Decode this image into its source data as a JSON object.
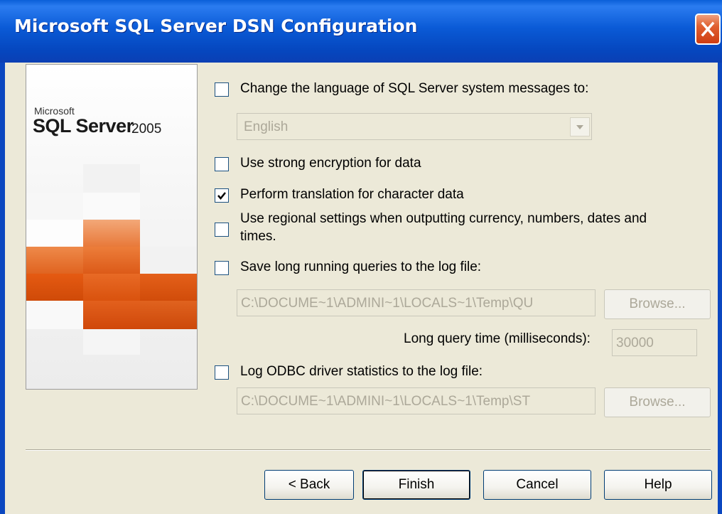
{
  "window": {
    "title": "Microsoft SQL Server DSN Configuration"
  },
  "logo": {
    "brand": "Microsoft",
    "product": "SQL Server",
    "year": "2005"
  },
  "options": {
    "language": {
      "checked": false,
      "label": "Change the language of SQL Server system messages to:",
      "selected": "English"
    },
    "encryption": {
      "checked": false,
      "label": "Use strong encryption for data"
    },
    "translation": {
      "checked": true,
      "label": "Perform translation for character data"
    },
    "regional": {
      "checked": false,
      "label_line1": "Use regional settings when outputting currency, numbers, dates and",
      "label_line2": "times."
    },
    "long_queries": {
      "checked": false,
      "label": "Save long running queries to the log file:",
      "path": "C:\\DOCUME~1\\ADMINI~1\\LOCALS~1\\Temp\\QU",
      "browse": "Browse...",
      "time_label": "Long query time (milliseconds):",
      "time_value": "30000"
    },
    "odbc_stats": {
      "checked": false,
      "label": "Log ODBC driver statistics to the log file:",
      "path": "C:\\DOCUME~1\\ADMINI~1\\LOCALS~1\\Temp\\ST",
      "browse": "Browse..."
    }
  },
  "buttons": {
    "back": "< Back",
    "finish": "Finish",
    "cancel": "Cancel",
    "help": "Help"
  },
  "icons": {
    "close": "close-icon",
    "check": "checkmark-icon",
    "dropdown": "chevron-down-icon"
  },
  "colors": {
    "titlebar": "#0a5ad6",
    "close": "#cf3d12",
    "dialog": "#ece9d8",
    "logo_orange": "#e05a1c"
  }
}
